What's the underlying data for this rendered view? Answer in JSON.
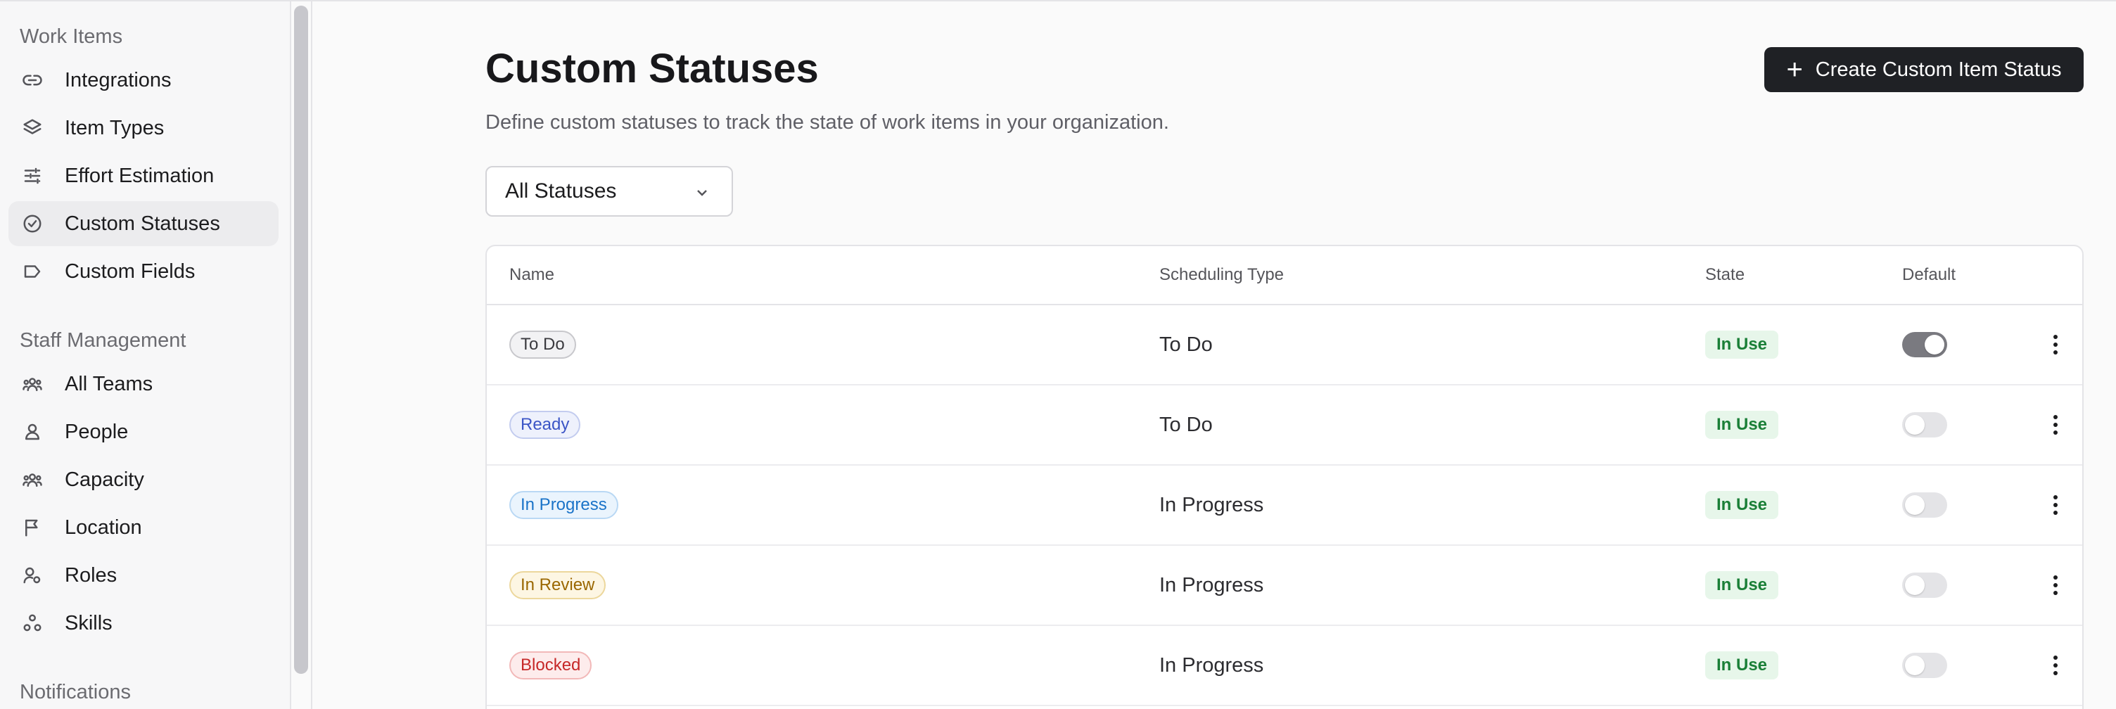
{
  "sidebar": {
    "sections": [
      {
        "heading": "Work Items",
        "items": [
          {
            "label": "Integrations",
            "icon": "link-icon",
            "active": false
          },
          {
            "label": "Item Types",
            "icon": "layers-icon",
            "active": false
          },
          {
            "label": "Effort Estimation",
            "icon": "sliders-icon",
            "active": false
          },
          {
            "label": "Custom Statuses",
            "icon": "check-circle-icon",
            "active": true
          },
          {
            "label": "Custom Fields",
            "icon": "tag-icon",
            "active": false
          }
        ]
      },
      {
        "heading": "Staff Management",
        "items": [
          {
            "label": "All Teams",
            "icon": "users-icon",
            "active": false
          },
          {
            "label": "People",
            "icon": "person-icon",
            "active": false
          },
          {
            "label": "Capacity",
            "icon": "users-icon",
            "active": false
          },
          {
            "label": "Location",
            "icon": "flag-icon",
            "active": false
          },
          {
            "label": "Roles",
            "icon": "person-gear-icon",
            "active": false
          },
          {
            "label": "Skills",
            "icon": "shapes-icon",
            "active": false
          }
        ]
      },
      {
        "heading": "Notifications",
        "items": []
      }
    ]
  },
  "main": {
    "title": "Custom Statuses",
    "description": "Define custom statuses to track the state of work items in your organization.",
    "create_button_label": "Create Custom Item Status",
    "filter": {
      "selected": "All Statuses"
    },
    "table": {
      "columns": [
        "Name",
        "Scheduling Type",
        "State",
        "Default"
      ],
      "rows": [
        {
          "name": "To Do",
          "tag_color": "#3a3a3f",
          "tag_bg": "#f2f2f4",
          "tag_border": "#c8c8cc",
          "scheduling_type": "To Do",
          "state": "In Use",
          "default": true
        },
        {
          "name": "Ready",
          "tag_color": "#3b55c6",
          "tag_bg": "#eef1fc",
          "tag_border": "#c3ccef",
          "scheduling_type": "To Do",
          "state": "In Use",
          "default": false
        },
        {
          "name": "In Progress",
          "tag_color": "#1a73c8",
          "tag_bg": "#eaf4fd",
          "tag_border": "#b9d8f4",
          "scheduling_type": "In Progress",
          "state": "In Use",
          "default": false
        },
        {
          "name": "In Review",
          "tag_color": "#9a6700",
          "tag_bg": "#fdf6e3",
          "tag_border": "#ecd79c",
          "scheduling_type": "In Progress",
          "state": "In Use",
          "default": false
        },
        {
          "name": "Blocked",
          "tag_color": "#c62828",
          "tag_bg": "#fdecec",
          "tag_border": "#f2b8b8",
          "scheduling_type": "In Progress",
          "state": "In Use",
          "default": false
        }
      ]
    }
  },
  "colors": {
    "primary_button": "#1f2125",
    "state_in_use_text": "#1a7f37",
    "state_in_use_bg": "#e7f6ea",
    "active_nav_bg": "#ececee"
  }
}
